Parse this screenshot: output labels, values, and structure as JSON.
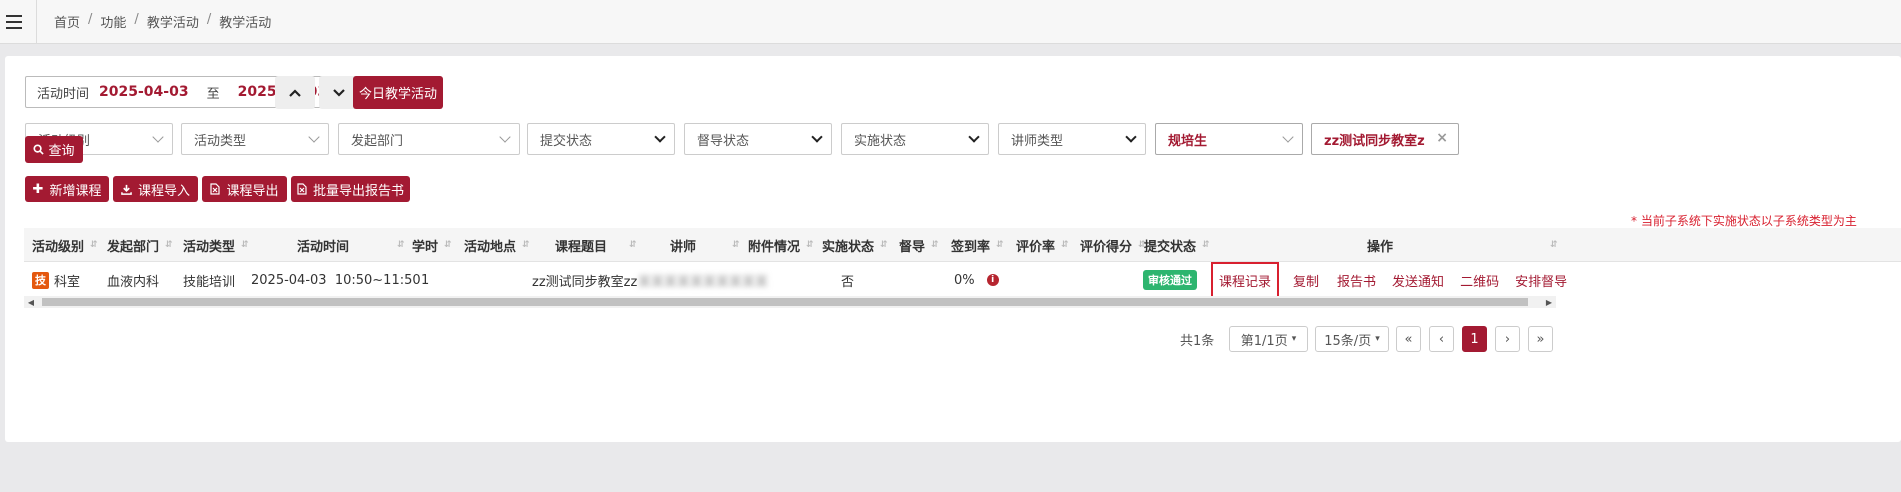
{
  "breadcrumb": [
    "首页",
    "功能",
    "教学活动",
    "教学活动"
  ],
  "filters": {
    "date_label": "活动时间",
    "date_start": "2025-04-03",
    "date_to": "至",
    "date_end": "2025-04-03",
    "today_button": "今日教学活动",
    "selects": [
      {
        "label": "活动级别"
      },
      {
        "label": "活动类型"
      },
      {
        "label": "发起部门"
      },
      {
        "label": "提交状态"
      },
      {
        "label": "督导状态"
      },
      {
        "label": "实施状态"
      },
      {
        "label": "讲师类型"
      },
      {
        "label": "规培生"
      },
      {
        "label": "zz测试同步教室z"
      }
    ],
    "query_button": "查询"
  },
  "toolbar": {
    "add": "新增课程",
    "import": "课程导入",
    "export": "课程导出",
    "batch_export": "批量导出报告书"
  },
  "note": "* 当前子系统下实施状态以子系统类型为主",
  "table": {
    "headers": [
      "活动级别",
      "发起部门",
      "活动类型",
      "活动时间",
      "学时",
      "活动地点",
      "课程题目",
      "讲师",
      "附件情况",
      "实施状态",
      "督导",
      "签到率",
      "评价率",
      "评价得分",
      "提交状态",
      "操作"
    ],
    "rows": [
      {
        "level_badge": "技",
        "level": "科室",
        "dept": "血液内科",
        "type": "技能培训",
        "time": "2025-04-03  10:50~11:50",
        "hours": "1",
        "location": "",
        "title": "zz测试同步教室zz",
        "lecturer": "某某某某某某某某某某",
        "attachment": "",
        "impl_status": "否",
        "supervisor": "",
        "sign_rate": "0%",
        "eval_rate": "",
        "eval_score": "",
        "submit_status": "审核通过",
        "ops": [
          "课程记录",
          "复制",
          "报告书",
          "发送通知",
          "二维码",
          "安排督导"
        ]
      }
    ]
  },
  "pagination": {
    "total": "共1条",
    "page_select": "第1/1页",
    "size_select": "15条/页",
    "first": "«",
    "prev": "‹",
    "current": "1",
    "next": "›",
    "last": "»"
  },
  "colors": {
    "brand": "#a31a32",
    "pass": "#2db56f",
    "badge": "#e4580f"
  }
}
